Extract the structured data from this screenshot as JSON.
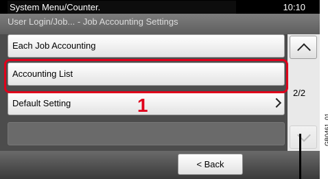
{
  "system_bar": {
    "title": "System Menu/Counter.",
    "time": "10:10"
  },
  "breadcrumb": "User Login/Job... - Job Accounting Settings",
  "list": {
    "items": [
      {
        "label": "Each Job Accounting"
      },
      {
        "label": "Accounting List"
      },
      {
        "label": "Default Setting"
      }
    ],
    "page_indicator": "2/2"
  },
  "callout": {
    "number": "1"
  },
  "footer": {
    "back_label": "< Back"
  },
  "figure_id": "GB0461_01",
  "colors": {
    "highlight": "#e0001b"
  }
}
